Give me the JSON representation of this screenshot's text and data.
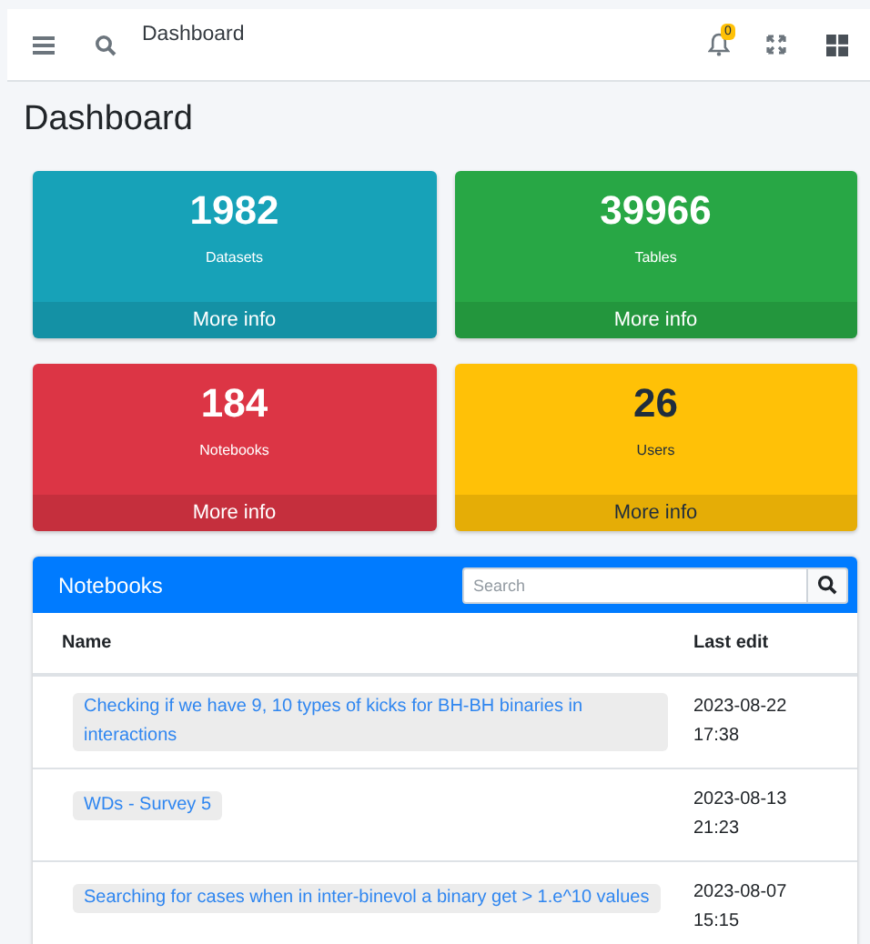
{
  "navbar": {
    "title": "Dashboard",
    "notifications": "0"
  },
  "page_title": "Dashboard",
  "stats": [
    {
      "value": "1982",
      "label": "Datasets",
      "link": "More info",
      "color": "#17a2b8"
    },
    {
      "value": "39966",
      "label": "Tables",
      "link": "More info",
      "color": "#28a745"
    },
    {
      "value": "184",
      "label": "Notebooks",
      "link": "More info",
      "color": "#dc3545"
    },
    {
      "value": "26",
      "label": "Users",
      "link": "More info",
      "color": "#ffc107"
    }
  ],
  "notebooks": {
    "title": "Notebooks",
    "search": {
      "placeholder": "Search"
    },
    "columns": [
      "Name",
      "Last edit"
    ],
    "rows": [
      {
        "name": "Checking if we have 9, 10 types of kicks for BH-BH binaries in interactions",
        "date": "2023-08-22",
        "time": "17:38"
      },
      {
        "name": "WDs - Survey 5",
        "date": "2023-08-13",
        "time": "21:23"
      },
      {
        "name": "Searching for cases when in inter-binevol a binary get > 1.e^10 values",
        "date": "2023-08-07",
        "time": "15:15"
      }
    ]
  }
}
